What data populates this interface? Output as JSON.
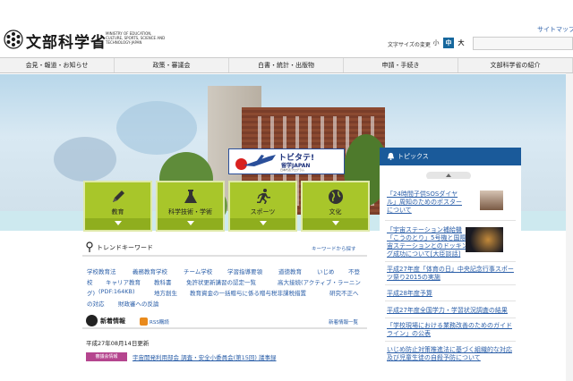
{
  "header": {
    "logo_ja": "文部科学省",
    "logo_en": "MINISTRY OF EDUCATION, CULTURE, SPORTS, SCIENCE AND TECHNOLOGY-JAPAN",
    "sitemap": "サイトマップ",
    "font_size_label": "文字サイズの変更",
    "font_sizes": [
      "小",
      "中",
      "大"
    ],
    "search_value": ""
  },
  "nav": {
    "items": [
      "会見・報道・お知らせ",
      "政策・審議会",
      "白書・統計・出版物",
      "申請・手続き",
      "文部科学省の紹介"
    ]
  },
  "banner": {
    "title": "トビタテ!",
    "subtitle": "留学JAPAN",
    "caption": "日本代表プログラム"
  },
  "tiles": [
    "教育",
    "科学技術・学術",
    "スポーツ",
    "文化"
  ],
  "trend": {
    "title": "トレンドキーワード",
    "more": "キーワードから探す",
    "row1": [
      "学校教育法",
      "義務教育学校",
      "チーム学校",
      "学習指導要領",
      "道徳教育",
      "いじめ",
      "不登"
    ],
    "row2": [
      "校",
      "キャリア教育",
      "教科書",
      "免許状更新講習の認定一覧",
      "高大接続(アクティブ・ラーニン"
    ],
    "row3": [
      "グ)",
      "(PDF:164KB)",
      "地方創生",
      "教育資金の一括贈与に係る贈与税非課税措置",
      "研究不正へ"
    ],
    "row4": [
      "の対応",
      "財政審への反論"
    ]
  },
  "news": {
    "title": "新着情報",
    "rss": "RSS購読",
    "more": "新着情報一覧",
    "date": "平成27年08月14日更新",
    "badge": "審議会情報",
    "link": "宇宙開発利用部会 調査・安全小委員会(第15回) 議事録"
  },
  "topics": {
    "title": "トピックス",
    "items": [
      [
        "「24時間子供SOSダイヤ",
        "ル」周知のためのポスター",
        "について"
      ],
      [
        "「宇宙ステーション補給機",
        "「こうのとり」5号機と国際宇",
        "宙ステーションとのドッキン",
        "グ成功について[大臣談話]"
      ],
      [
        "平成27年度「体育の日」中央記念行事スポー",
        "ツ祭り2015の実施"
      ],
      [
        "平成28年度予算"
      ],
      [
        "平成27年度全国学力・学習状況調査の結果"
      ],
      [
        "「学校現場における業務改善のためのガイド",
        "ライン」の公表"
      ],
      [
        "いじめ防止対策推進法に基づく組織的な対応",
        "及び児童生徒の自殺予防について"
      ]
    ]
  }
}
